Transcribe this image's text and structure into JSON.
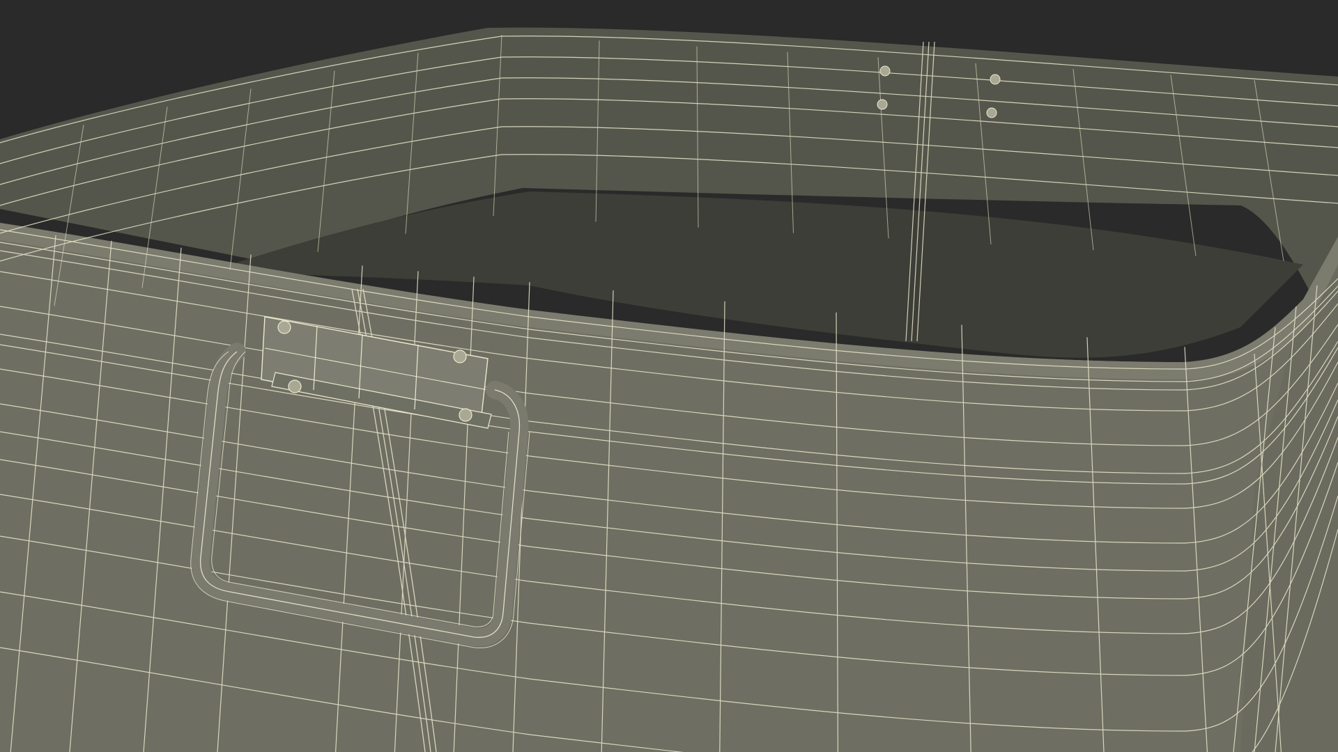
{
  "scene": {
    "subject": "wireframe-tub",
    "colors": {
      "background": "#2a2a2a",
      "outer_wall": "#6e6f62",
      "inner_wall": "#55564b",
      "inner_floor": "#3f403a",
      "rim": "#7b7c6e",
      "wire": "#ece9cf",
      "handle": "#7a7b6e",
      "rivet": "#a9a894"
    },
    "icons": [
      "rivet-icon",
      "handle-icon"
    ]
  }
}
